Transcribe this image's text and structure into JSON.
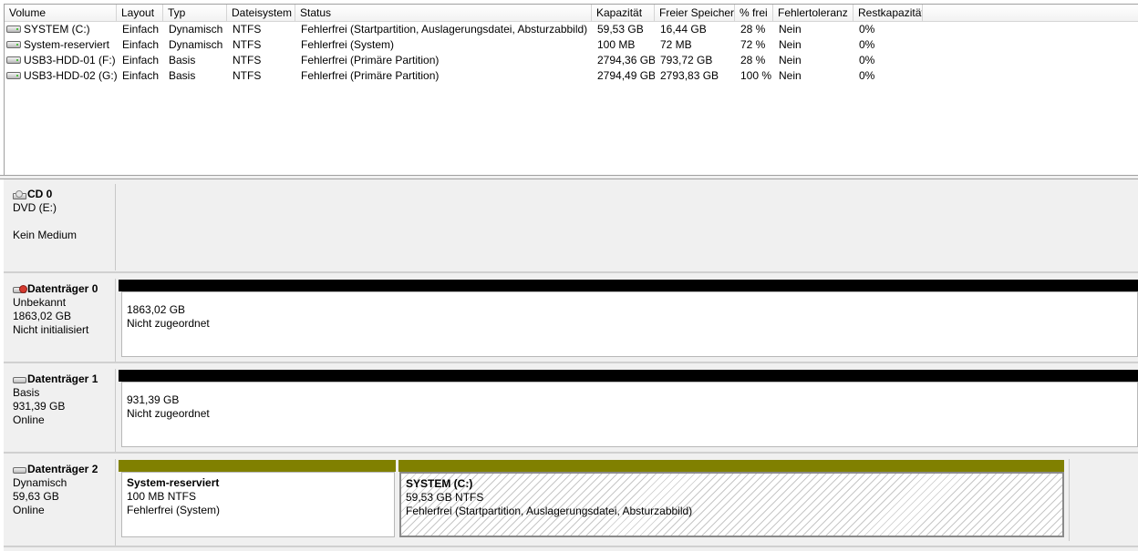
{
  "volume_list": {
    "columns": [
      "Volume",
      "Layout",
      "Typ",
      "Dateisystem",
      "Status",
      "Kapazität",
      "Freier Speicher",
      "% frei",
      "Fehlertoleranz",
      "Restkapazität"
    ],
    "rows": [
      [
        "SYSTEM (C:)",
        "Einfach",
        "Dynamisch",
        "NTFS",
        "Fehlerfrei (Startpartition, Auslagerungsdatei, Absturzabbild)",
        "59,53 GB",
        "16,44 GB",
        "28 %",
        "Nein",
        "0%"
      ],
      [
        "System-reserviert",
        "Einfach",
        "Dynamisch",
        "NTFS",
        "Fehlerfrei (System)",
        "100 MB",
        "72 MB",
        "72 %",
        "Nein",
        "0%"
      ],
      [
        "USB3-HDD-01 (F:)",
        "Einfach",
        "Basis",
        "NTFS",
        "Fehlerfrei (Primäre Partition)",
        "2794,36 GB",
        "793,72 GB",
        "28 %",
        "Nein",
        "0%"
      ],
      [
        "USB3-HDD-02 (G:)",
        "Einfach",
        "Basis",
        "NTFS",
        "Fehlerfrei (Primäre Partition)",
        "2794,49 GB",
        "2793,83 GB",
        "100 %",
        "Nein",
        "0%"
      ]
    ]
  },
  "disks": {
    "cd0": {
      "name": "CD 0",
      "line1": "DVD (E:)",
      "line2": "",
      "line3": "Kein Medium",
      "icon": "cd-drive-icon"
    },
    "disk0": {
      "name": "Datenträger 0",
      "line1": "Unbekannt",
      "line2": "1863,02 GB",
      "line3": "Nicht initialisiert",
      "icon": "hdd-error-icon",
      "partition": {
        "size": "1863,02 GB",
        "status": "Nicht zugeordnet"
      }
    },
    "disk1": {
      "name": "Datenträger 1",
      "line1": "Basis",
      "line2": "931,39 GB",
      "line3": "Online",
      "icon": "hdd-icon",
      "partition": {
        "size": "931,39 GB",
        "status": "Nicht zugeordnet"
      }
    },
    "disk2": {
      "name": "Datenträger 2",
      "line1": "Dynamisch",
      "line2": "59,63 GB",
      "line3": "Online",
      "icon": "hdd-icon",
      "partitions": [
        {
          "title": "System-reserviert",
          "fs": "100 MB NTFS",
          "status": "Fehlerfrei (System)"
        },
        {
          "title": "SYSTEM  (C:)",
          "fs": "59,53 GB NTFS",
          "status": "Fehlerfrei (Startpartition, Auslagerungsdatei, Absturzabbild)"
        }
      ]
    }
  },
  "colors": {
    "unallocated_bar": "#000000",
    "simple_volume_bar": "#808000"
  }
}
